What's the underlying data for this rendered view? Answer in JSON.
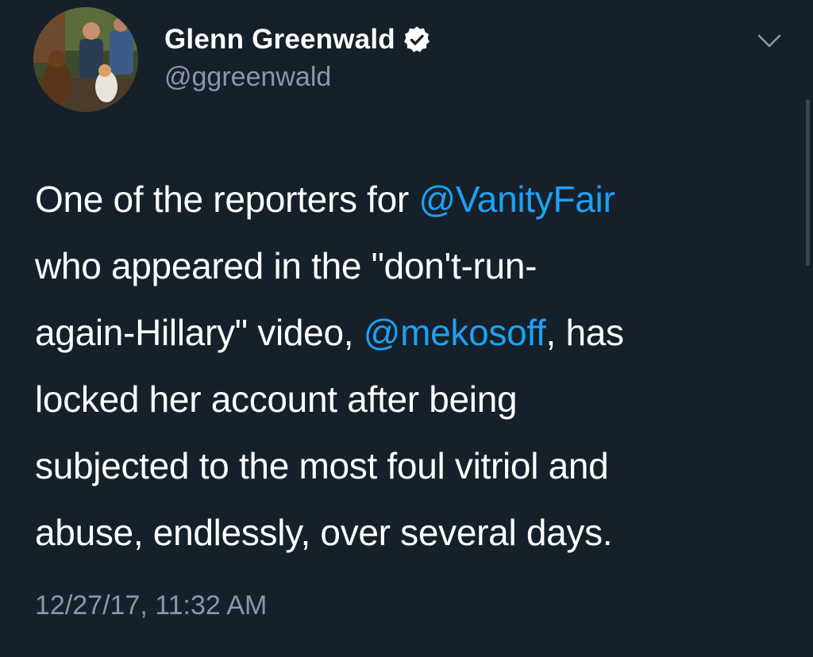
{
  "author": {
    "display_name": "Glenn Greenwald",
    "handle": "@ggreenwald",
    "verified": true
  },
  "tweet": {
    "lines": [
      {
        "parts": [
          {
            "text": "One of the reporters for "
          },
          {
            "text": "@VanityFair",
            "mention": true
          }
        ]
      },
      {
        "parts": [
          {
            "text": "who appeared in the \"don't-run-"
          }
        ]
      },
      {
        "parts": [
          {
            "text": "again-Hillary\" video, "
          },
          {
            "text": "@mekosoff",
            "mention": true
          },
          {
            "text": ", has"
          }
        ]
      },
      {
        "parts": [
          {
            "text": "locked her account after being"
          }
        ]
      },
      {
        "parts": [
          {
            "text": "subjected to the most foul vitriol and"
          }
        ]
      },
      {
        "parts": [
          {
            "text": "abuse, endlessly, over several days."
          }
        ]
      }
    ],
    "timestamp": "12/27/17, 11:32 AM"
  },
  "icons": {
    "verified": "verified-badge-icon",
    "menu": "chevron-down-icon"
  },
  "colors": {
    "background": "#15202b",
    "text": "#ffffff",
    "secondary": "#8899a6",
    "link": "#1da1f2"
  }
}
